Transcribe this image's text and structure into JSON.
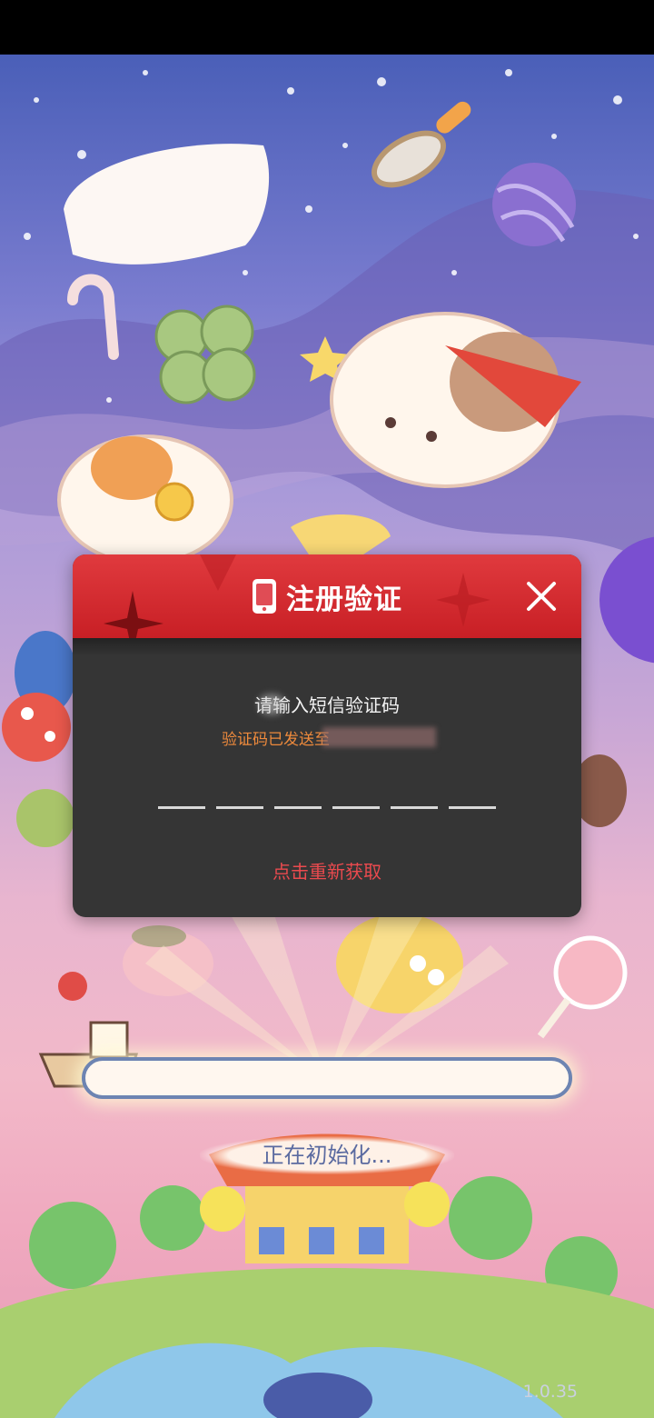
{
  "dialog": {
    "title": "注册验证",
    "prompt": "请输入短信验证码",
    "sent_text": "验证码已发送至",
    "resend_label": "点击重新获取",
    "code_length": 6
  },
  "loading": {
    "status": "正在初始化...",
    "progress": 0
  },
  "version": "1.0.35",
  "icons": {
    "phone": "phone-icon",
    "close": "close-icon"
  },
  "colors": {
    "header_red": "#d32a2f",
    "panel_dark": "#353535",
    "accent_orange": "#ee8a3c",
    "resend_red": "#ea4a4e"
  }
}
